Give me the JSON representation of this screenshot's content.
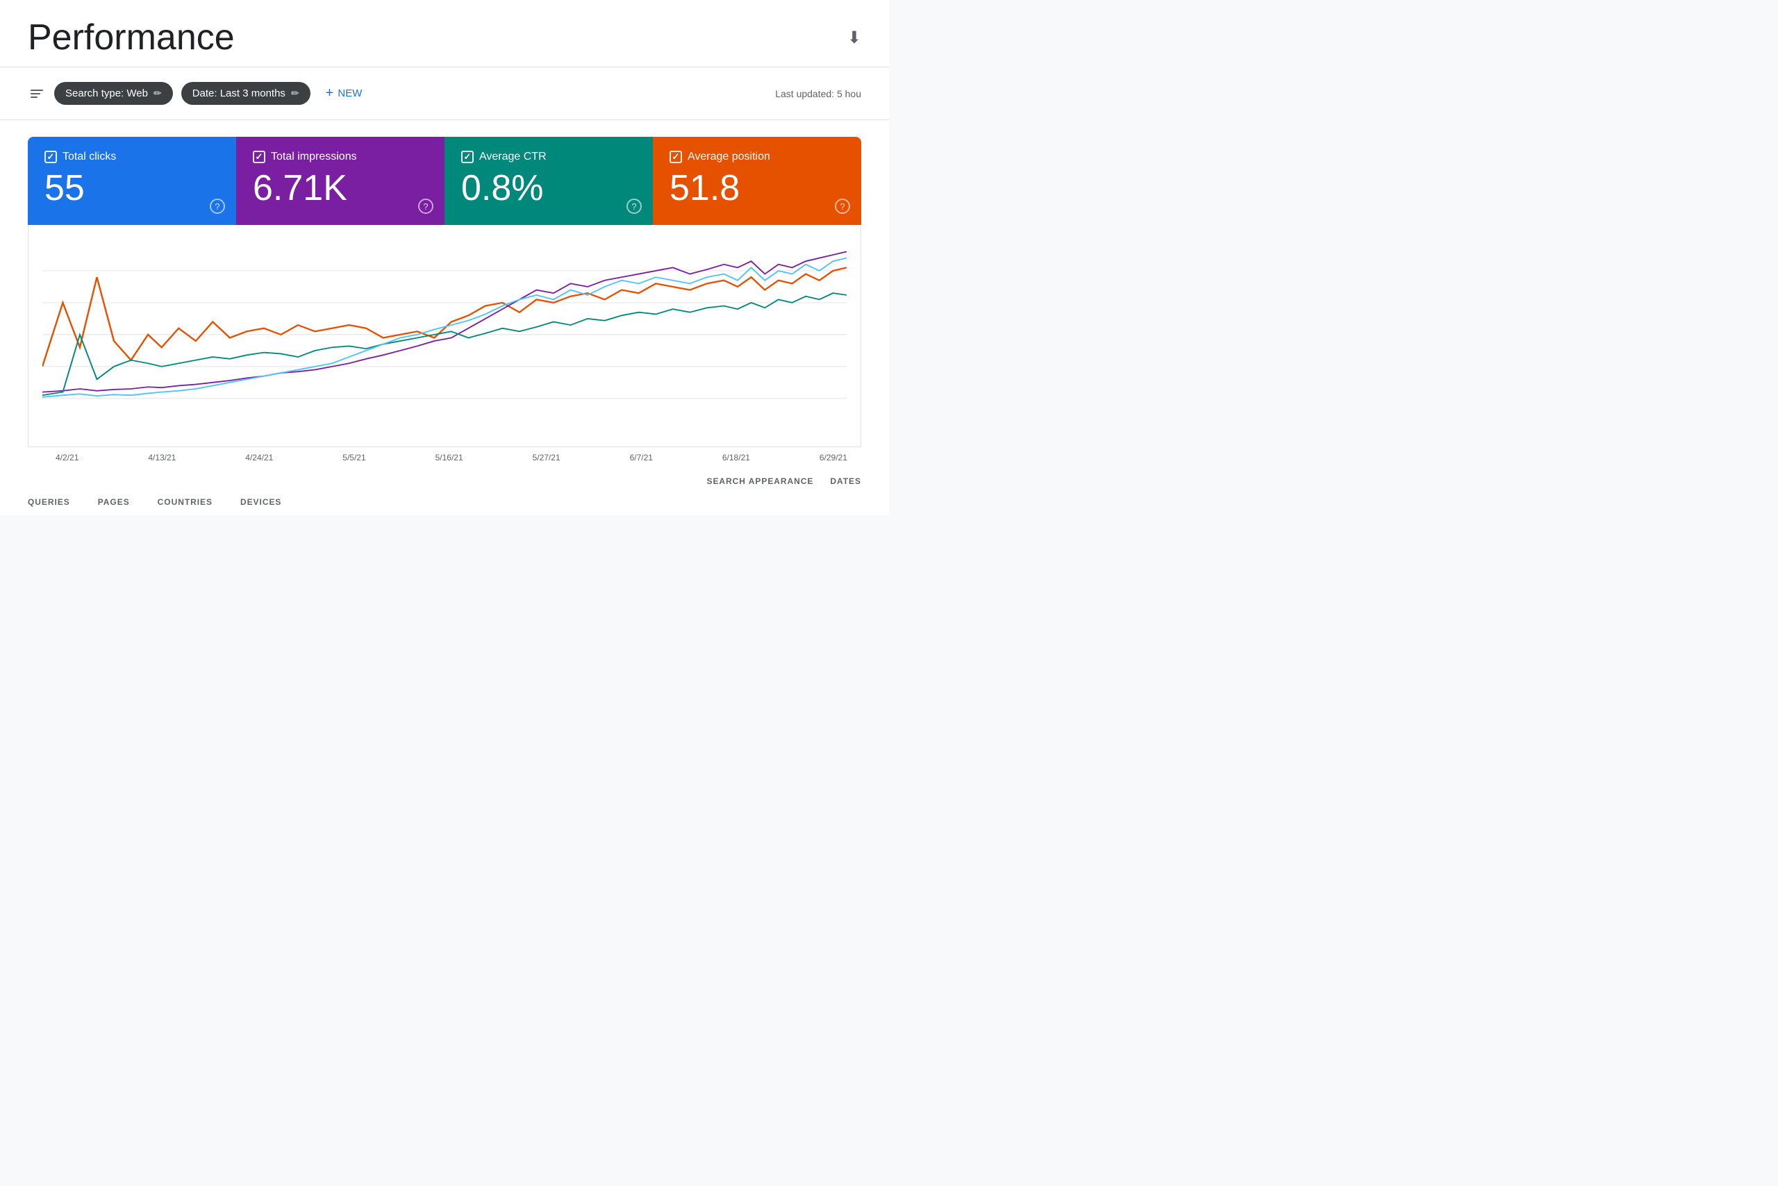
{
  "header": {
    "title": "Performance",
    "download_icon": "⬇"
  },
  "toolbar": {
    "search_type_chip": "Search type: Web",
    "date_chip": "Date: Last 3 months",
    "new_button": "NEW",
    "last_updated": "Last updated: 5 hou"
  },
  "metrics": [
    {
      "id": "clicks",
      "label": "Total clicks",
      "value": "55",
      "color": "#1a73e8"
    },
    {
      "id": "impressions",
      "label": "Total impressions",
      "value": "6.71K",
      "color": "#7b1fa2"
    },
    {
      "id": "ctr",
      "label": "Average CTR",
      "value": "0.8%",
      "color": "#00897b"
    },
    {
      "id": "position",
      "label": "Average position",
      "value": "51.8",
      "color": "#e65100"
    }
  ],
  "chart": {
    "x_labels": [
      "4/2/21",
      "4/13/21",
      "4/24/21",
      "5/5/21",
      "5/16/21",
      "5/27/21",
      "6/7/21",
      "6/18/21",
      "6/29/21"
    ],
    "lines": {
      "clicks_color": "#e65100",
      "impressions_color": "#7b1fa2",
      "ctr_color": "#00897b",
      "position_color": "#1a73e8"
    }
  },
  "tabs": {
    "right_tabs": [
      "DATES",
      "SEARCH APPEARANCE"
    ],
    "bottom_tabs": [
      "QUERIES",
      "PAGES",
      "COUNTRIES",
      "DEVICES"
    ]
  }
}
